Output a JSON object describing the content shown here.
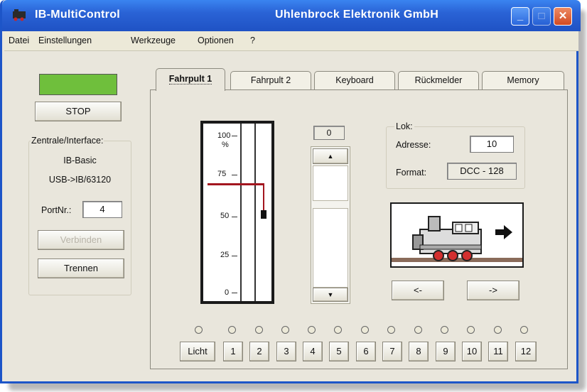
{
  "window": {
    "title_left": "IB-MultiControl",
    "title_center": "Uhlenbrock Elektronik GmbH",
    "controls": {
      "minimize": "_",
      "maximize": "□",
      "close": "✕"
    }
  },
  "menu": [
    "Datei",
    "Einstellungen",
    "Werkzeuge",
    "Optionen",
    "?"
  ],
  "left_panel": {
    "status_color": "#6fbf3c",
    "stop_label": "STOP",
    "group_title": "Zentrale/Interface:",
    "device": "IB-Basic",
    "interface": "USB->IB/63120",
    "port_label": "PortNr.:",
    "port_value": "4",
    "connect_label": "Verbinden",
    "disconnect_label": "Trennen"
  },
  "tabs": [
    "Fahrpult 1",
    "Fahrpult 2",
    "Keyboard",
    "Rückmelder",
    "Memory"
  ],
  "speed": {
    "scale": [
      "100",
      "%",
      "75",
      "50",
      "25",
      "0"
    ],
    "value_percent": 70
  },
  "step_display": "0",
  "scroll": {
    "up": "▲",
    "down": "▼"
  },
  "loco": {
    "group_title": "Lok:",
    "address_label": "Adresse:",
    "address_value": "10",
    "format_label": "Format:",
    "format_value": "DCC - 128",
    "direction_icon": "arrow-right"
  },
  "direction": {
    "back": "<-",
    "forward": "->"
  },
  "functions": [
    "Licht",
    "1",
    "2",
    "3",
    "4",
    "5",
    "6",
    "7",
    "8",
    "9",
    "10",
    "11",
    "12"
  ],
  "colors": {
    "titlebar": "#2a63d6",
    "speed_line": "#a3161f",
    "panel": "#e9e6dc"
  }
}
